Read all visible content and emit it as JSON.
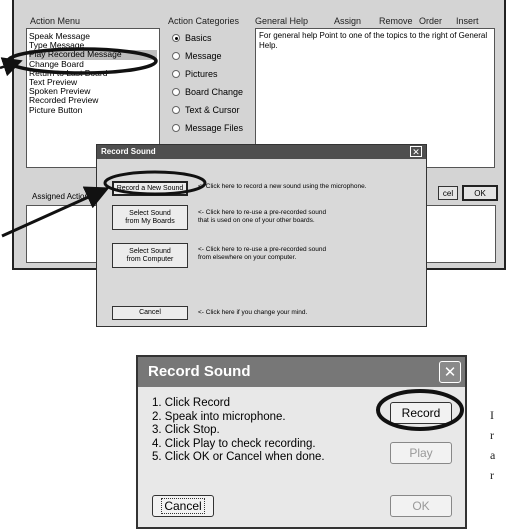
{
  "action_window": {
    "headers": {
      "action_menu": "Action Menu",
      "action_categories": "Action Categories",
      "general_help": "General Help",
      "assign": "Assign",
      "remove": "Remove",
      "order": "Order",
      "insert": "Insert"
    },
    "action_menu_items": [
      "Speak Message",
      "Type Message",
      "Play Recorded Message",
      "Change Board",
      "Return to Last Board",
      "Text Preview",
      "Spoken Preview",
      "Recorded Preview",
      "Picture Button"
    ],
    "selected_menu_item": "Play Recorded Message",
    "categories": [
      {
        "label": "Basics",
        "selected": true
      },
      {
        "label": "Message",
        "selected": false
      },
      {
        "label": "Pictures",
        "selected": false
      },
      {
        "label": "Board Change",
        "selected": false
      },
      {
        "label": "Text & Cursor",
        "selected": false
      },
      {
        "label": "Message Files",
        "selected": false
      }
    ],
    "help_text": "For general help Point to one of the topics to the right of General Help.",
    "assigned_actions_label": "Assigned Actions",
    "cancel_partial": "cel",
    "ok_label": "OK"
  },
  "record_dialog_small": {
    "title": "Record Sound",
    "buttons": [
      {
        "label": "Record a New Sound",
        "hint": "<- Click here to record a new sound using the microphone."
      },
      {
        "label": "Select Sound\nfrom My Boards",
        "hint": "<- Click here to re-use a pre-recorded sound\n   that is used on one of your other boards."
      },
      {
        "label": "Select Sound\nfrom Computer",
        "hint": "<- Click here to re-use a pre-recorded sound\n   from elsewhere on your computer."
      },
      {
        "label": "Cancel",
        "hint": "<- Click here if you change your mind."
      }
    ]
  },
  "record_dialog_large": {
    "title": "Record Sound",
    "steps": [
      "1. Click Record",
      "2. Speak into microphone.",
      "3. Click Stop.",
      "4. Click Play to check recording.",
      "5. Click OK or Cancel when done."
    ],
    "record_label": "Record",
    "play_label": "Play",
    "cancel_label": "Cancel",
    "ok_label": "OK"
  },
  "page_edge_text": [
    "I",
    "r",
    "a",
    "r"
  ]
}
